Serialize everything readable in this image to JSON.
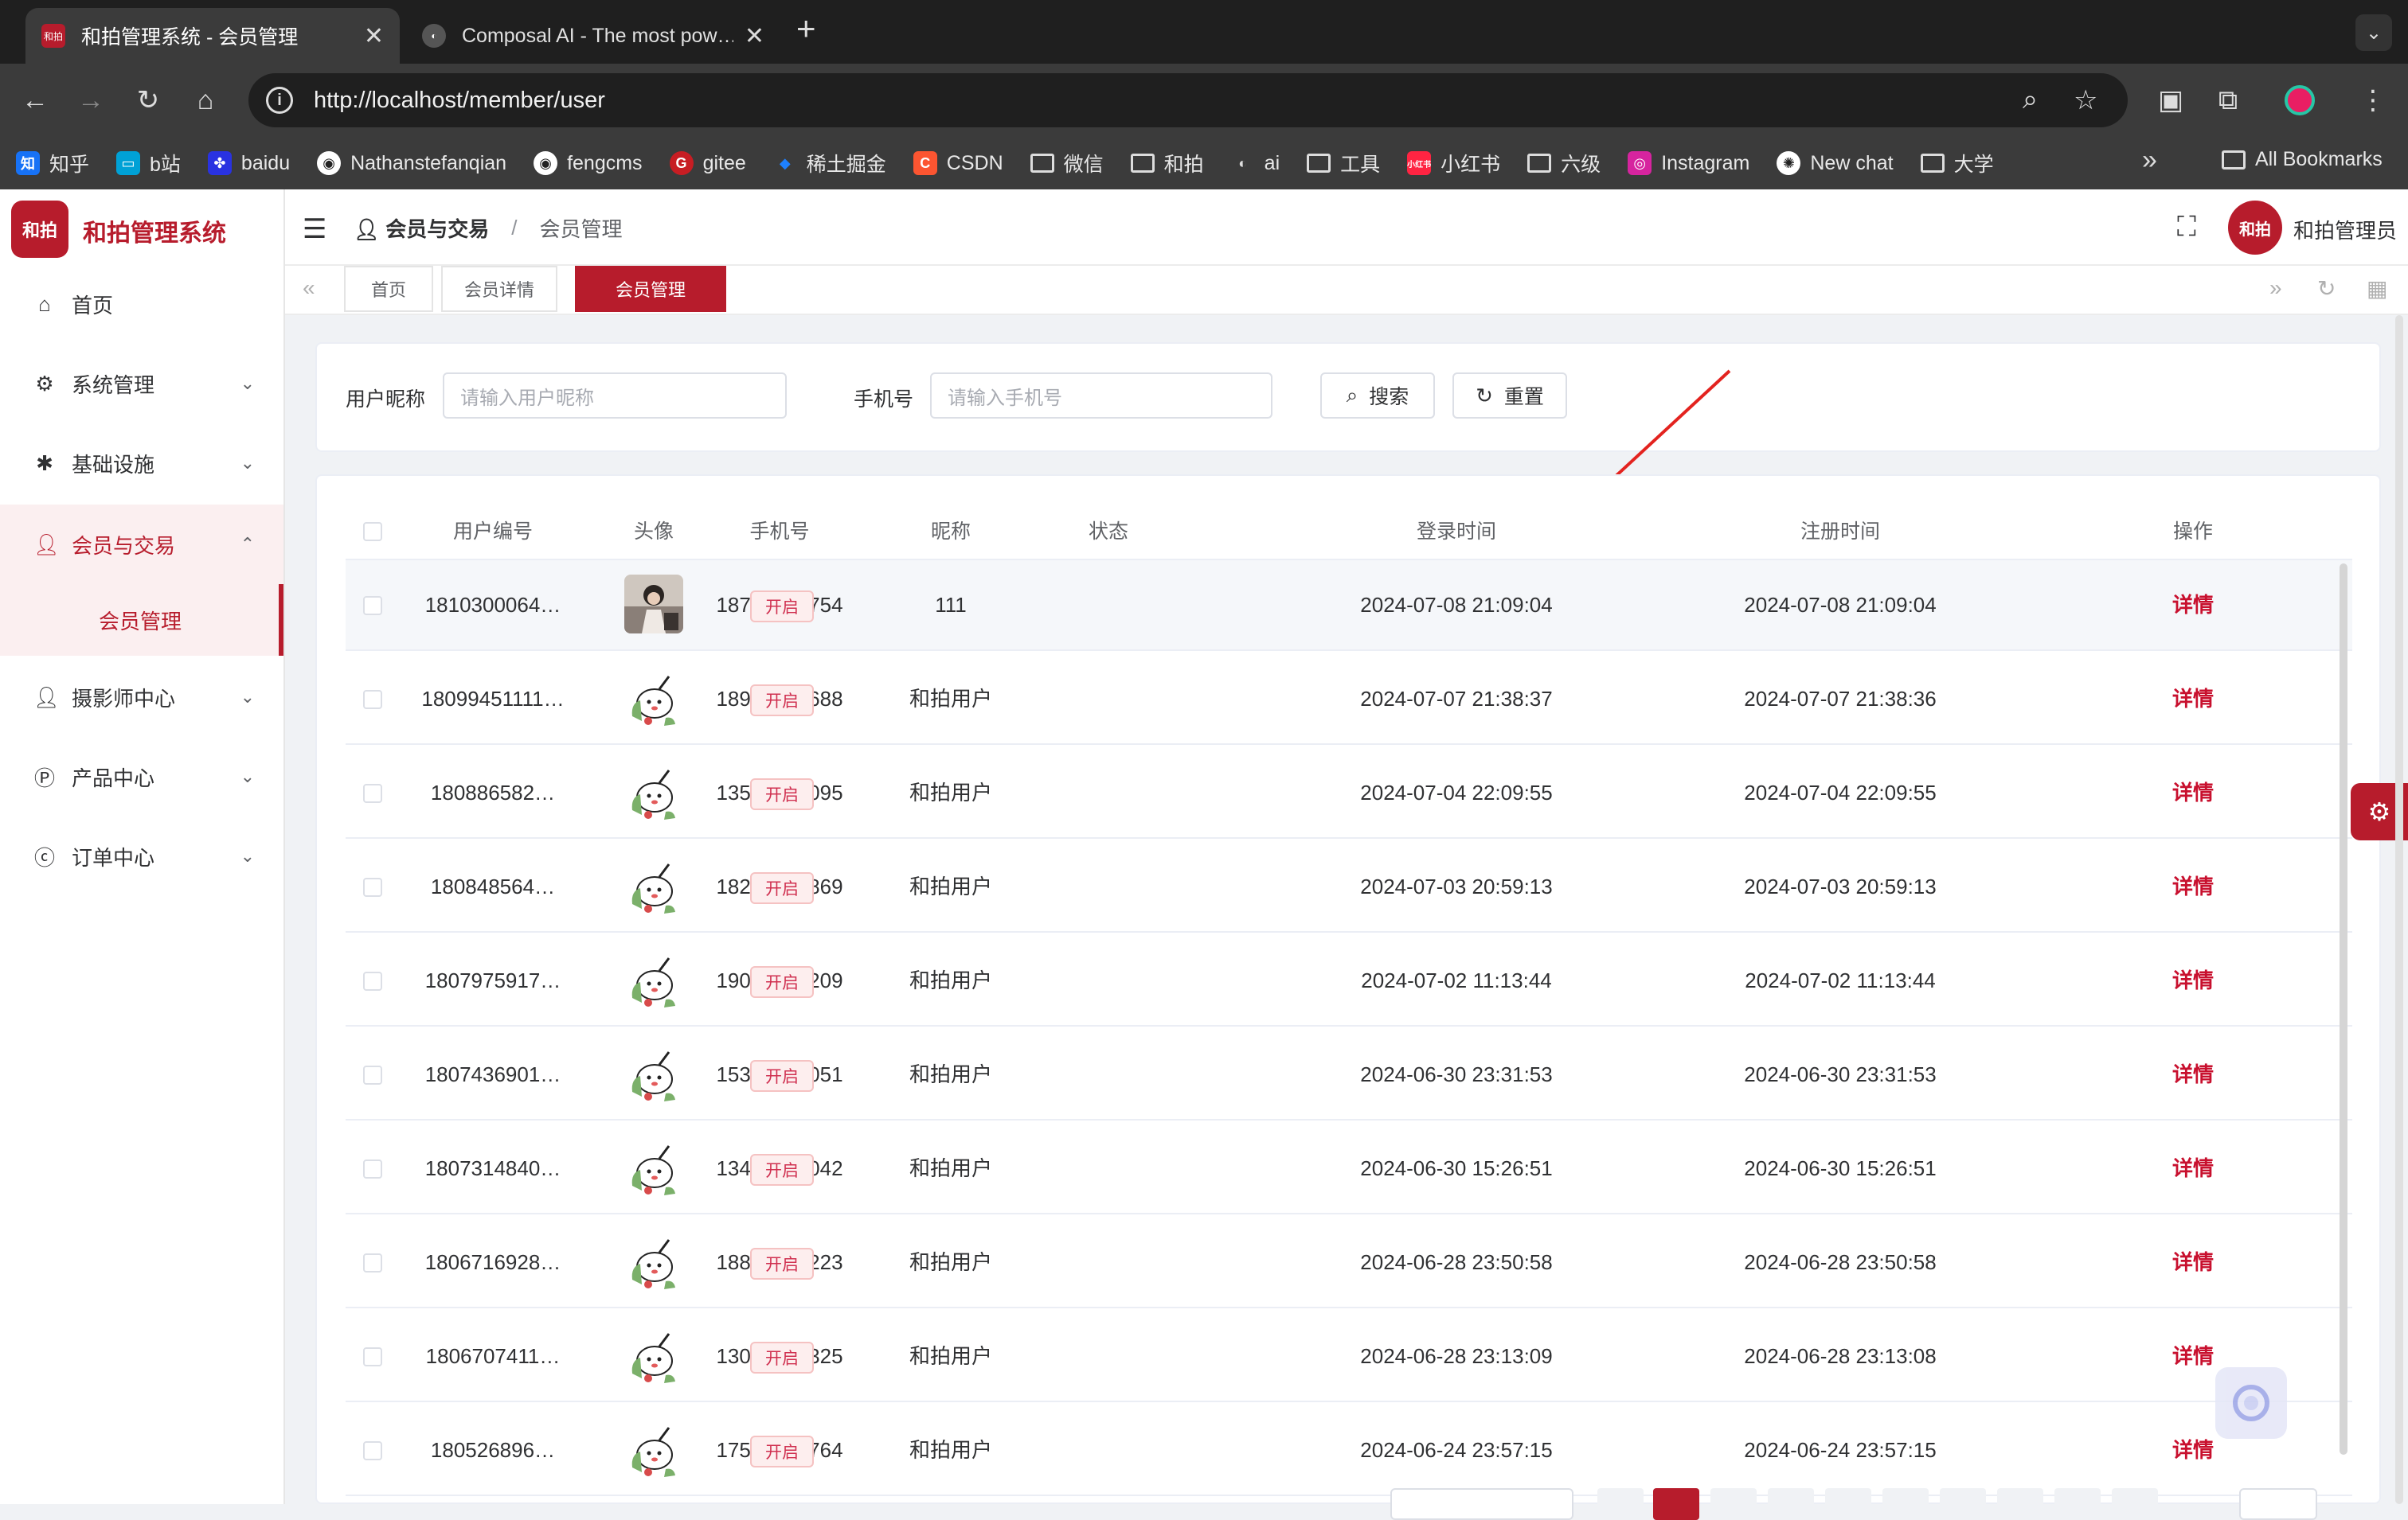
{
  "browser": {
    "tabs": [
      {
        "title": "和拍管理系统 - 会员管理",
        "active": true
      },
      {
        "title": "Composal AI - The most pow…",
        "active": false
      }
    ],
    "url": "http://localhost/member/user",
    "bookmarks": [
      {
        "label": "知乎",
        "icon": "zhihu-icon",
        "color": "#1772f6",
        "glyph": "知"
      },
      {
        "label": "b站",
        "icon": "bilibili-icon",
        "color": "#00a1d6",
        "glyph": "b"
      },
      {
        "label": "baidu",
        "icon": "baidu-icon",
        "color": "#2932e1",
        "glyph": "du"
      },
      {
        "label": "Nathanstefanqian",
        "icon": "github-icon",
        "color": "#333333",
        "glyph": "◉"
      },
      {
        "label": "fengcms",
        "icon": "github-icon",
        "color": "#333333",
        "glyph": "◉"
      },
      {
        "label": "gitee",
        "icon": "gitee-icon",
        "color": "#c71d23",
        "glyph": "G"
      },
      {
        "label": "稀土掘金",
        "icon": "juejin-icon",
        "color": "#1e80ff",
        "glyph": "◆"
      },
      {
        "label": "CSDN",
        "icon": "csdn-icon",
        "color": "#fc5531",
        "glyph": "C"
      },
      {
        "label": "微信",
        "icon": "folder-icon",
        "folder": true
      },
      {
        "label": "和拍",
        "icon": "folder-icon",
        "folder": true
      },
      {
        "label": "ai",
        "icon": "ai-icon",
        "color": "#555555",
        "glyph": "◐"
      },
      {
        "label": "工具",
        "icon": "folder-icon",
        "folder": true
      },
      {
        "label": "小红书",
        "icon": "xiaohongshu-icon",
        "color": "#ff2442",
        "glyph": "小"
      },
      {
        "label": "六级",
        "icon": "folder-icon",
        "folder": true
      },
      {
        "label": "Instagram",
        "icon": "instagram-icon",
        "color": "#d6249f",
        "glyph": "◎"
      },
      {
        "label": "New chat",
        "icon": "chatgpt-icon",
        "color": "#ffffff",
        "glyph": "✺"
      },
      {
        "label": "大学",
        "icon": "folder-icon",
        "folder": true
      }
    ],
    "all_bookmarks": "All Bookmarks"
  },
  "app": {
    "logo_text": "和拍",
    "brand": "和拍管理系统",
    "accent": "#b71c2c",
    "menu": [
      {
        "label": "首页",
        "icon": "home-icon",
        "has_children": false
      },
      {
        "label": "系统管理",
        "icon": "gear-icon",
        "has_children": true
      },
      {
        "label": "基础设施",
        "icon": "asterisk-icon",
        "has_children": true
      },
      {
        "label": "会员与交易",
        "icon": "user-icon",
        "has_children": true,
        "open": true
      },
      {
        "label": "摄影师中心",
        "icon": "user-icon",
        "has_children": true
      },
      {
        "label": "产品中心",
        "icon": "product-icon",
        "has_children": true
      },
      {
        "label": "订单中心",
        "icon": "order-icon",
        "has_children": true
      }
    ],
    "submenu_active": "会员管理",
    "breadcrumb": [
      "会员与交易",
      "会员管理"
    ],
    "user_avatar_text": "和拍",
    "user_name": "和拍管理员",
    "tags": [
      {
        "label": "首页",
        "active": false
      },
      {
        "label": "会员详情",
        "active": false
      },
      {
        "label": "会员管理",
        "active": true
      }
    ]
  },
  "filters": {
    "nickname_label": "用户昵称",
    "nickname_placeholder": "请输入用户昵称",
    "phone_label": "手机号",
    "phone_placeholder": "请输入手机号",
    "search_label": "搜索",
    "reset_label": "重置"
  },
  "table": {
    "columns": [
      "用户编号",
      "头像",
      "手机号",
      "昵称",
      "状态",
      "登录时间",
      "注册时间",
      "操作"
    ],
    "rows": [
      {
        "id": "1810300064…",
        "avatar": "photo",
        "phone": "18752469754",
        "nickname": "111",
        "status": "开启",
        "login": "2024-07-08 21:09:04",
        "register": "2024-07-08 21:09:04",
        "action": "详情"
      },
      {
        "id": "18099451111…",
        "avatar": "cartoon",
        "phone": "18921865688",
        "nickname": "和拍用户",
        "status": "开启",
        "login": "2024-07-07 21:38:37",
        "register": "2024-07-07 21:38:36",
        "action": "详情"
      },
      {
        "id": "180886582…",
        "avatar": "cartoon",
        "phone": "13530270095",
        "nickname": "和拍用户",
        "status": "开启",
        "login": "2024-07-04 22:09:55",
        "register": "2024-07-04 22:09:55",
        "action": "详情"
      },
      {
        "id": "180848564…",
        "avatar": "cartoon",
        "phone": "18251201869",
        "nickname": "和拍用户",
        "status": "开启",
        "login": "2024-07-03 20:59:13",
        "register": "2024-07-03 20:59:13",
        "action": "详情"
      },
      {
        "id": "1807975917…",
        "avatar": "cartoon",
        "phone": "19074952209",
        "nickname": "和拍用户",
        "status": "开启",
        "login": "2024-07-02 11:13:44",
        "register": "2024-07-02 11:13:44",
        "action": "详情"
      },
      {
        "id": "1807436901…",
        "avatar": "cartoon",
        "phone": "15398623051",
        "nickname": "和拍用户",
        "status": "开启",
        "login": "2024-06-30 23:31:53",
        "register": "2024-06-30 23:31:53",
        "action": "详情"
      },
      {
        "id": "1807314840…",
        "avatar": "cartoon",
        "phone": "13478919042",
        "nickname": "和拍用户",
        "status": "开启",
        "login": "2024-06-30 15:26:51",
        "register": "2024-06-30 15:26:51",
        "action": "详情"
      },
      {
        "id": "1806716928…",
        "avatar": "cartoon",
        "phone": "18865796223",
        "nickname": "和拍用户",
        "status": "开启",
        "login": "2024-06-28 23:50:58",
        "register": "2024-06-28 23:50:58",
        "action": "详情"
      },
      {
        "id": "1806707411…",
        "avatar": "cartoon",
        "phone": "13074393325",
        "nickname": "和拍用户",
        "status": "开启",
        "login": "2024-06-28 23:13:09",
        "register": "2024-06-28 23:13:08",
        "action": "详情"
      },
      {
        "id": "180526896…",
        "avatar": "cartoon",
        "phone": "17516217764",
        "nickname": "和拍用户",
        "status": "开启",
        "login": "2024-06-24 23:57:15",
        "register": "2024-06-24 23:57:15",
        "action": "详情"
      }
    ]
  }
}
